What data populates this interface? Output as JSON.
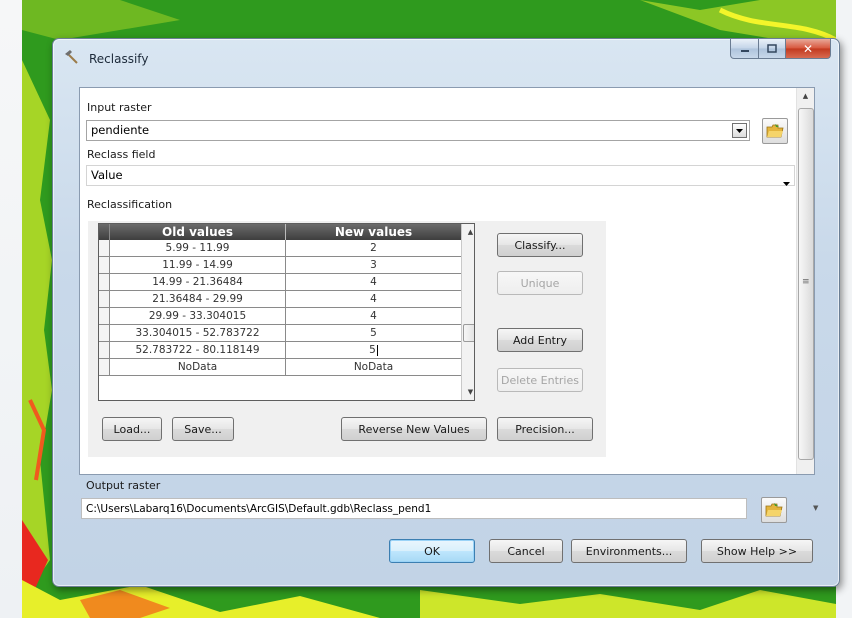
{
  "window": {
    "title": "Reclassify"
  },
  "form": {
    "input_raster_label": "Input raster",
    "input_raster_value": "pendiente",
    "reclass_field_label": "Reclass field",
    "reclass_field_value": "Value",
    "reclassification_label": "Reclassification",
    "output_raster_label": "Output raster",
    "output_raster_value": "C:\\Users\\Labarq16\\Documents\\ArcGIS\\Default.gdb\\Reclass_pend1"
  },
  "table": {
    "headers": [
      "Old values",
      "New values"
    ],
    "rows": [
      {
        "old": "5.99 - 11.99",
        "new": "2"
      },
      {
        "old": "11.99 - 14.99",
        "new": "3"
      },
      {
        "old": "14.99 - 21.36484",
        "new": "4"
      },
      {
        "old": "21.36484 - 29.99",
        "new": "4"
      },
      {
        "old": "29.99 - 33.304015",
        "new": "4"
      },
      {
        "old": "33.304015 - 52.783722",
        "new": "5"
      },
      {
        "old": "52.783722 - 80.118149",
        "new": "5"
      },
      {
        "old": "NoData",
        "new": "NoData"
      }
    ]
  },
  "buttons": {
    "classify": "Classify...",
    "unique": "Unique",
    "add_entry": "Add Entry",
    "delete_entries": "Delete Entries",
    "load": "Load...",
    "save": "Save...",
    "reverse": "Reverse New Values",
    "precision": "Precision...",
    "ok": "OK",
    "cancel": "Cancel",
    "environments": "Environments...",
    "show_help": "Show Help >>"
  },
  "colors": {
    "map_green": "#2f9a1e",
    "window_frame": "#c9d9ea",
    "close_red": "#c2391f"
  }
}
